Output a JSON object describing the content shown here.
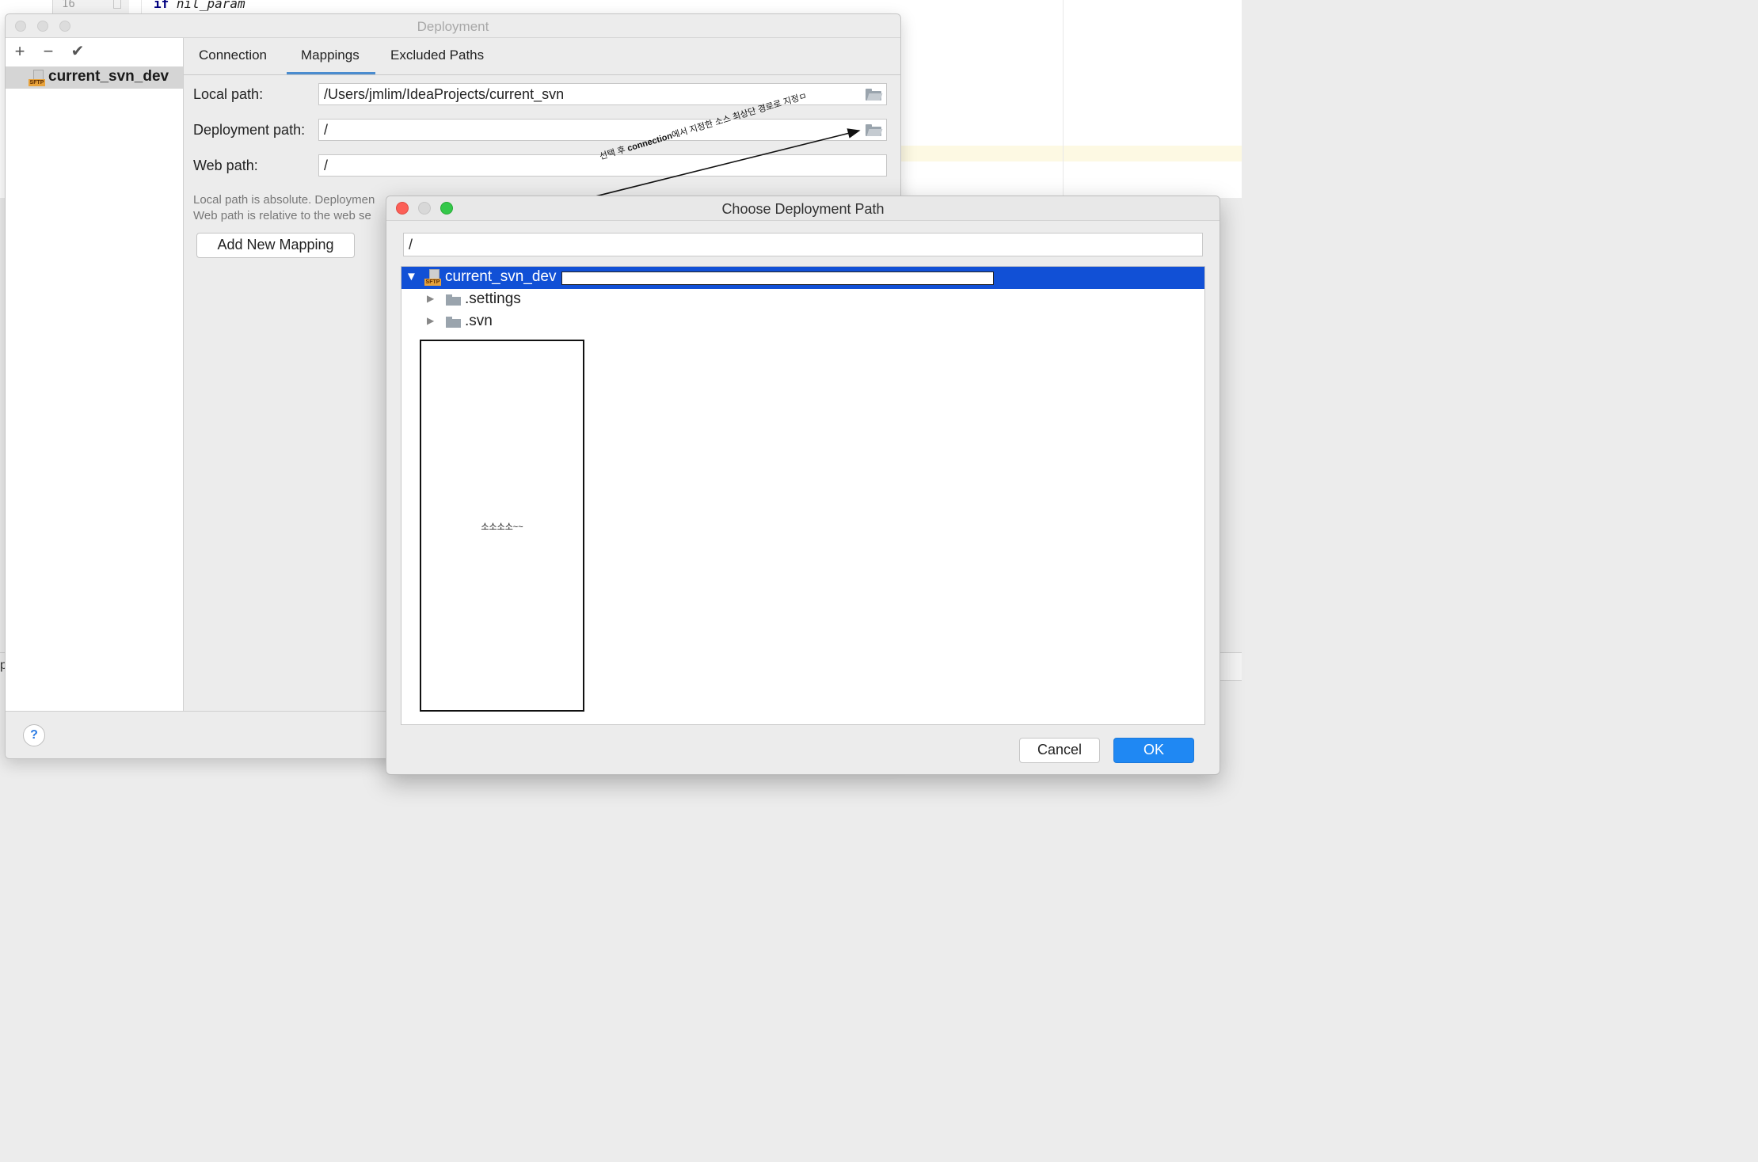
{
  "editor": {
    "line_number": "16",
    "code_keyword": "if",
    "code_text": "nil_param",
    "left_char": "pi"
  },
  "deployment": {
    "title": "Deployment",
    "toolbar": {
      "add": "+",
      "remove": "−",
      "apply": "✔"
    },
    "server": {
      "name": "current_svn_dev",
      "badge": "SFTP"
    },
    "tabs": [
      {
        "label": "Connection"
      },
      {
        "label": "Mappings",
        "active": true
      },
      {
        "label": "Excluded Paths"
      }
    ],
    "mappings": {
      "local_path_label": "Local path:",
      "local_path_value": "/Users/jmlim/IdeaProjects/current_svn",
      "deployment_path_label": "Deployment path:",
      "deployment_path_value": "/",
      "web_path_label": "Web path:",
      "web_path_value": "/",
      "help_line1": "Local path is absolute. Deploymen",
      "help_line2": "Web path is relative to the web se",
      "add_mapping_button": "Add New Mapping"
    },
    "help_button": "?"
  },
  "annotation": {
    "prefix": "선택 후 ",
    "bold": "connection",
    "suffix": "에서 지정한 소스 최상단 경로로 지정ㅁ"
  },
  "chooser": {
    "title": "Choose Deployment Path",
    "path_value": "/",
    "tree": {
      "root": {
        "label": "current_svn_dev",
        "badge": "SFTP",
        "expanded": true,
        "selected": true
      },
      "children": [
        {
          "label": ".settings"
        },
        {
          "label": ".svn"
        }
      ]
    },
    "redaction_label": "소소소소~~",
    "cancel_button": "Cancel",
    "ok_button": "OK"
  },
  "colors": {
    "selection": "#1150d6",
    "primary_button": "#1f88f3",
    "tab_underline": "#4a8ccf",
    "close": "#fc5f57",
    "zoom": "#34c84a"
  }
}
